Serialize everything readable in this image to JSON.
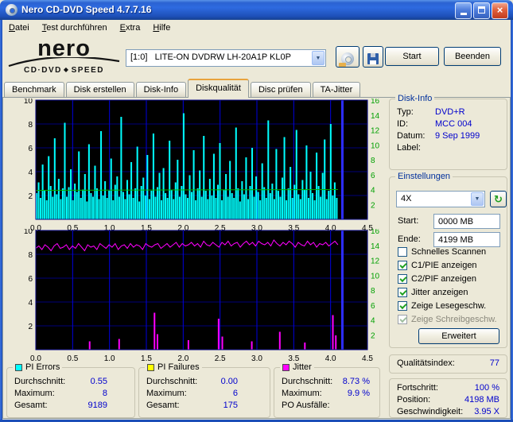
{
  "window": {
    "title": "Nero CD-DVD Speed 4.7.7.16"
  },
  "icons": {
    "close": "×",
    "dropdown": "▼",
    "refresh": "↻",
    "diamond": "◆"
  },
  "menu": {
    "items": [
      "Datei",
      "Test durchführen",
      "Extra",
      "Hilfe"
    ]
  },
  "logo": {
    "brand": "nero",
    "product_left": "CD·DVD",
    "product_right": "SPEED"
  },
  "toolbar": {
    "drive": "[1:0]   LITE-ON DVDRW LH-20A1P KL0P",
    "start_label": "Start",
    "quit_label": "Beenden"
  },
  "tabs": {
    "items": [
      "Benchmark",
      "Disk erstellen",
      "Disk-Info",
      "Diskqualität",
      "Disc prüfen",
      "TA-Jitter"
    ],
    "active_index": 3
  },
  "disk_info": {
    "title": "Disk-Info",
    "rows": [
      {
        "label": "Typ:",
        "value": "DVD+R"
      },
      {
        "label": "ID:",
        "value": "MCC 004"
      },
      {
        "label": "Datum:",
        "value": "9 Sep 1999"
      },
      {
        "label": "Label:",
        "value": ""
      }
    ]
  },
  "settings": {
    "title": "Einstellungen",
    "speed": "4X",
    "start_label": "Start:",
    "start_value": "0000 MB",
    "end_label": "Ende:",
    "end_value": "4199 MB",
    "checkboxes": [
      {
        "label": "Schnelles Scannen",
        "checked": false
      },
      {
        "label": "C1/PIE anzeigen",
        "checked": true
      },
      {
        "label": "C2/PIF anzeigen",
        "checked": true
      },
      {
        "label": "Jitter anzeigen",
        "checked": true
      },
      {
        "label": "Zeige Lesegeschw.",
        "checked": true
      },
      {
        "label": "Zeige Schreibgeschw.",
        "checked": true,
        "disabled": true
      }
    ],
    "advanced_label": "Erweitert"
  },
  "quality": {
    "label": "Qualitätsindex:",
    "value": "77"
  },
  "progress": {
    "rows": [
      {
        "label": "Fortschritt:",
        "value": "100 %"
      },
      {
        "label": "Position:",
        "value": "4198 MB"
      },
      {
        "label": "Geschwindigkeit:",
        "value": "3.95 X"
      }
    ]
  },
  "stats": {
    "pi_errors": {
      "title": "PI Errors",
      "color": "#00FFFF",
      "rows": [
        [
          "Durchschnitt:",
          "0.55"
        ],
        [
          "Maximum:",
          "8"
        ],
        [
          "Gesamt:",
          "9189"
        ]
      ]
    },
    "pi_failures": {
      "title": "PI Failures",
      "color": "#FFFF00",
      "rows": [
        [
          "Durchschnitt:",
          "0.00"
        ],
        [
          "Maximum:",
          "6"
        ],
        [
          "Gesamt:",
          "175"
        ]
      ]
    },
    "jitter": {
      "title": "Jitter",
      "color": "#FF00FF",
      "rows": [
        [
          "Durchschnitt:",
          "8.73 %"
        ],
        [
          "Maximum:",
          "9.9 %"
        ],
        [
          "PO Ausfälle:",
          ""
        ]
      ]
    }
  },
  "chart_data": [
    {
      "type": "bar",
      "title": "PI Errors vs. disc position (GB)",
      "color": "#00ffff",
      "xlim": [
        0,
        4.5
      ],
      "ylim": [
        0,
        10
      ],
      "yright_lim": [
        0,
        16
      ],
      "yticks_left": [
        2,
        4,
        6,
        8,
        10
      ],
      "yticks_right": [
        2,
        4,
        6,
        8,
        10,
        12,
        14,
        16
      ],
      "xticks": [
        0,
        0.5,
        1,
        1.5,
        2,
        2.5,
        3,
        3.5,
        4,
        4.5
      ],
      "x_end": 4.1,
      "cursor_x": 4.16,
      "speed_line": {
        "start": 3.9,
        "end": 4.0,
        "color": "#00b000"
      },
      "values": [
        2.2,
        3.1,
        1.8,
        4.6,
        2.4,
        1.6,
        5.3,
        2.8,
        1.9,
        6.8,
        2.1,
        3.4,
        1.7,
        2.6,
        8.1,
        1.9,
        2.7,
        4.2,
        1.6,
        3.0,
        2.3,
        5.7,
        1.8,
        2.5,
        3.8,
        1.5,
        6.3,
        2.2,
        1.9,
        4.5,
        2.6,
        1.7,
        7.4,
        2.0,
        3.2,
        1.8,
        2.4,
        5.1,
        1.6,
        2.9,
        3.6,
        1.9,
        8.6,
        2.3,
        1.7,
        3.3,
        2.1,
        4.8,
        1.8,
        2.6,
        6.1,
        1.5,
        2.8,
        3.5,
        2.0,
        5.4,
        1.7,
        2.4,
        7.2,
        1.9,
        2.7,
        3.9,
        1.6,
        4.3,
        2.2,
        1.8,
        6.6,
        2.5,
        1.7,
        3.1,
        5.0,
        1.9,
        2.8,
        8.9,
        2.1,
        1.8,
        3.7,
        2.3,
        5.8,
        1.6,
        2.6,
        4.1,
        1.9,
        7.0,
        2.4,
        1.7,
        3.4,
        2.0,
        5.5,
        1.8,
        2.9,
        6.4,
        1.6,
        2.5,
        3.8,
        1.9,
        4.9,
        2.2,
        1.8,
        7.7,
        2.6,
        1.5,
        3.2,
        2.1,
        5.2,
        1.7,
        2.8,
        6.0,
        1.9,
        3.6,
        2.3,
        1.6,
        4.7,
        2.7,
        1.8,
        8.3,
        2.2,
        3.0,
        1.7,
        5.9,
        2.4,
        1.9,
        3.5,
        6.9,
        1.6,
        2.6,
        4.4,
        1.8,
        2.9,
        7.5,
        2.1,
        1.7,
        3.3,
        2.5,
        6.2,
        1.8,
        4.0,
        2.2,
        1.6,
        5.6,
        2.8,
        1.9,
        3.9,
        6.7,
        1.7,
        2.4,
        8.0,
        2.0,
        3.1,
        1.8
      ]
    },
    {
      "type": "line+spikes",
      "title": "Jitter (%) and PI Failures vs. disc position (GB)",
      "line_color": "#ff00ff",
      "spike_color": "#ff00ff",
      "xlim": [
        0,
        4.5
      ],
      "ylim": [
        0,
        10
      ],
      "yright_lim": [
        0,
        16
      ],
      "yticks_left": [
        2,
        4,
        6,
        8,
        10
      ],
      "yticks_right": [
        2,
        4,
        6,
        8,
        10,
        12,
        14,
        16
      ],
      "xticks": [
        0,
        0.5,
        1,
        1.5,
        2,
        2.5,
        3,
        3.5,
        4,
        4.5
      ],
      "x_end": 4.1,
      "cursor_x": 4.16,
      "line_values": [
        8.5,
        8.7,
        8.4,
        8.8,
        8.6,
        8.3,
        8.7,
        8.9,
        8.5,
        8.6,
        8.8,
        8.4,
        8.7,
        8.5,
        8.9,
        8.6,
        8.3,
        8.8,
        8.6,
        8.7,
        8.4,
        8.9,
        8.7,
        8.5,
        8.8,
        8.6,
        8.9,
        8.4,
        8.7,
        8.8,
        8.5,
        8.9,
        8.6,
        8.8,
        8.7,
        8.4,
        8.9,
        8.7,
        8.6,
        8.8,
        8.9,
        8.5,
        8.7,
        8.9,
        8.6,
        8.8,
        9.0,
        8.6,
        8.9,
        8.7,
        8.8,
        9.0,
        8.7,
        8.9,
        8.6,
        9.1,
        8.8,
        8.7,
        9.0,
        8.8,
        8.6,
        9.0,
        8.8,
        9.1,
        8.7,
        8.9,
        9.0,
        8.6,
        8.9,
        9.1,
        8.8,
        9.0,
        8.7,
        9.1,
        8.9,
        8.8,
        9.0,
        8.7,
        9.2,
        8.9,
        8.7,
        9.0,
        8.8,
        9.1,
        8.9,
        8.6,
        9.0,
        8.8,
        8.7,
        9.1,
        8.8,
        9.0,
        8.6,
        8.9,
        8.8,
        9.0,
        8.7,
        8.9,
        9.1,
        8.8
      ],
      "spikes": [
        {
          "x": 0.72,
          "v": 0.7
        },
        {
          "x": 1.12,
          "v": 0.9
        },
        {
          "x": 1.6,
          "v": 3.1
        },
        {
          "x": 1.64,
          "v": 1.3
        },
        {
          "x": 2.06,
          "v": 0.8
        },
        {
          "x": 2.47,
          "v": 2.6
        },
        {
          "x": 2.52,
          "v": 1.1
        },
        {
          "x": 2.92,
          "v": 0.7
        },
        {
          "x": 3.3,
          "v": 1.5
        },
        {
          "x": 3.64,
          "v": 0.6
        },
        {
          "x": 4.02,
          "v": 2.9
        },
        {
          "x": 4.06,
          "v": 1.2
        }
      ]
    }
  ]
}
